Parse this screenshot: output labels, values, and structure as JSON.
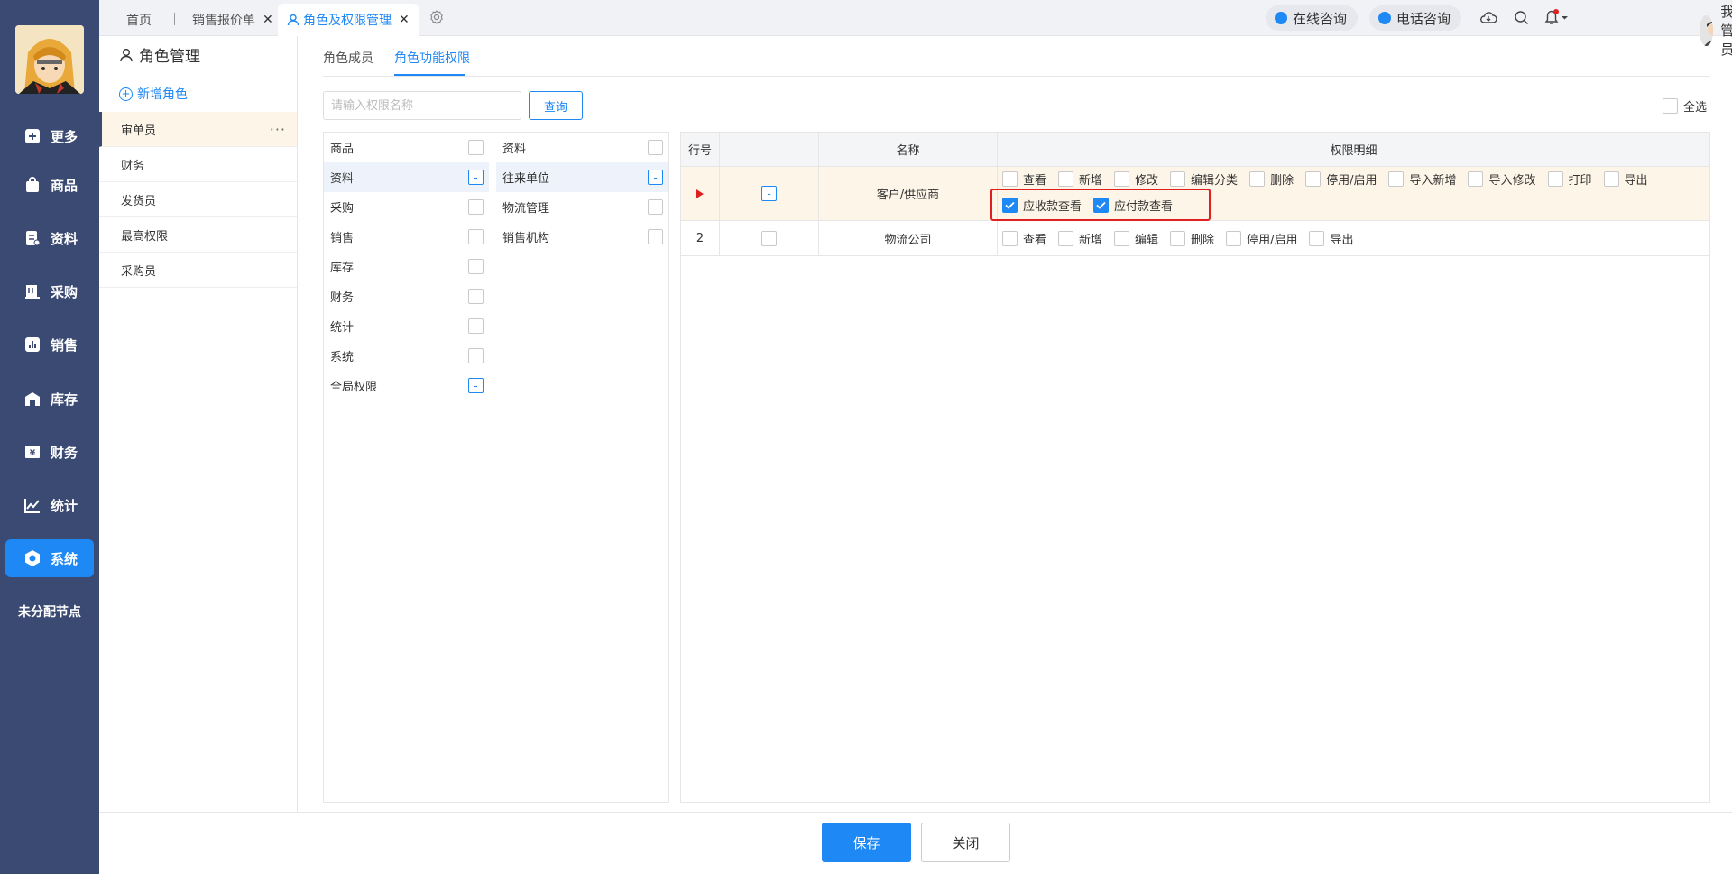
{
  "nav": {
    "items": [
      {
        "label": "更多",
        "icon": "plus-square-icon"
      },
      {
        "label": "商品",
        "icon": "bag-icon"
      },
      {
        "label": "资料",
        "icon": "document-icon"
      },
      {
        "label": "采购",
        "icon": "purchase-icon"
      },
      {
        "label": "销售",
        "icon": "bar-chart-icon"
      },
      {
        "label": "库存",
        "icon": "warehouse-icon"
      },
      {
        "label": "财务",
        "icon": "yen-icon"
      },
      {
        "label": "统计",
        "icon": "trend-icon"
      },
      {
        "label": "系统",
        "icon": "hexagon-icon",
        "active": true
      }
    ],
    "unassigned": "未分配节点"
  },
  "tabs": [
    {
      "label": "首页"
    },
    {
      "label": "销售报价单",
      "close": "✕"
    },
    {
      "label": "角色及权限管理",
      "close": "✕",
      "active": true
    }
  ],
  "topbar": {
    "online_consult": "在线咨询",
    "phone_consult": "电话咨询",
    "user_name": "我是管理员"
  },
  "roles": {
    "title": "角色管理",
    "add_label": "新增角色",
    "items": [
      {
        "name": "审单员",
        "active": true,
        "more": "···"
      },
      {
        "name": "财务"
      },
      {
        "name": "发货员"
      },
      {
        "name": "最高权限"
      },
      {
        "name": "采购员"
      }
    ]
  },
  "subtabs": {
    "members": "角色成员",
    "permissions": "角色功能权限"
  },
  "search": {
    "placeholder": "请输入权限名称",
    "button": "查询",
    "select_all": "全选"
  },
  "categories": {
    "left": [
      {
        "label": "商品",
        "state": "none"
      },
      {
        "label": "资料",
        "state": "partial"
      },
      {
        "label": "采购",
        "state": "none"
      },
      {
        "label": "销售",
        "state": "none"
      },
      {
        "label": "库存",
        "state": "none"
      },
      {
        "label": "财务",
        "state": "none"
      },
      {
        "label": "统计",
        "state": "none"
      },
      {
        "label": "系统",
        "state": "none"
      },
      {
        "label": "全局权限",
        "state": "partial"
      }
    ],
    "right": [
      {
        "label": "资料",
        "state": "none"
      },
      {
        "label": "往来单位",
        "state": "partial"
      },
      {
        "label": "物流管理",
        "state": "none"
      },
      {
        "label": "销售机构",
        "state": "none"
      }
    ]
  },
  "table": {
    "headers": {
      "row_no": "行号",
      "name": "名称",
      "detail": "权限明细"
    },
    "rows": [
      {
        "row_no": "▸",
        "name": "客户/供应商",
        "state": "partial",
        "perms_line1": [
          {
            "label": "查看",
            "checked": false
          },
          {
            "label": "新增",
            "checked": false
          },
          {
            "label": "修改",
            "checked": false
          },
          {
            "label": "编辑分类",
            "checked": false
          },
          {
            "label": "删除",
            "checked": false
          },
          {
            "label": "停用/启用",
            "checked": false
          },
          {
            "label": "导入新增",
            "checked": false
          },
          {
            "label": "导入修改",
            "checked": false
          },
          {
            "label": "打印",
            "checked": false
          },
          {
            "label": "导出",
            "checked": false
          }
        ],
        "perms_line2": [
          {
            "label": "应收款查看",
            "checked": true
          },
          {
            "label": "应付款查看",
            "checked": true
          }
        ]
      },
      {
        "row_no": "2",
        "name": "物流公司",
        "state": "none",
        "perms_line1": [
          {
            "label": "查看",
            "checked": false
          },
          {
            "label": "新增",
            "checked": false
          },
          {
            "label": "编辑",
            "checked": false
          },
          {
            "label": "删除",
            "checked": false
          },
          {
            "label": "停用/启用",
            "checked": false
          },
          {
            "label": "导出",
            "checked": false
          }
        ]
      }
    ]
  },
  "footer": {
    "save": "保存",
    "close": "关闭"
  },
  "colors": {
    "accent": "#1e88f5",
    "sidebar": "#3b4a72",
    "highlight": "#e02020"
  }
}
